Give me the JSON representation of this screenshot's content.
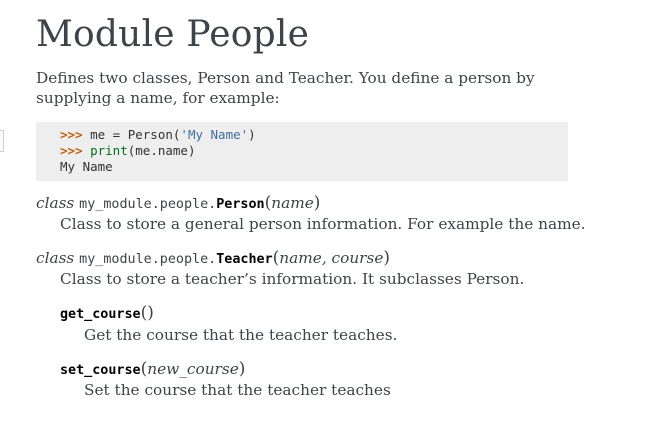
{
  "page": {
    "title": "Module People",
    "intro": "Defines two classes, Person and Teacher. You define a person by supplying a name, for example:"
  },
  "code": {
    "prompt": ">>>",
    "line1_code": " me = Person(",
    "line1_str": "'My Name'",
    "line1_end": ")",
    "line2_builtin": "print",
    "line2_end": "(me.name)",
    "output": "My Name"
  },
  "person_class": {
    "keyword": "class",
    "prefix": "my_module.people.",
    "name": "Person",
    "open_paren": "(",
    "params": "name",
    "close_paren": ")",
    "description": "Class to store a general person information. For example the name."
  },
  "teacher_class": {
    "keyword": "class",
    "prefix": "my_module.people.",
    "name": "Teacher",
    "open_paren": "(",
    "params": "name, course",
    "close_paren": ")",
    "description": "Class to store a teacher’s information. It subclasses Person."
  },
  "get_course": {
    "name": "get_course",
    "open_paren": "(",
    "params": "",
    "close_paren": ")",
    "description": "Get the course that the teacher teaches."
  },
  "set_course": {
    "name": "set_course",
    "open_paren": "(",
    "params": "new_course",
    "close_paren": ")",
    "description": "Set the course that the teacher teaches"
  }
}
